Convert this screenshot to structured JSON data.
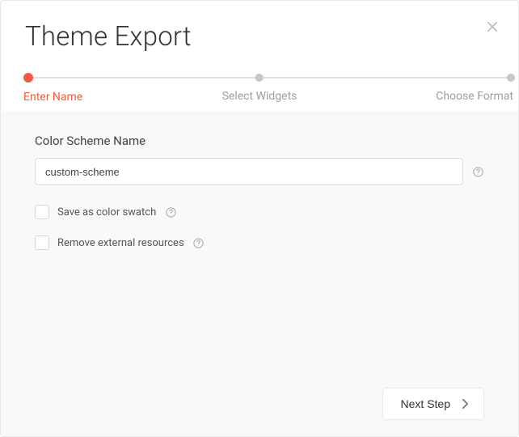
{
  "dialog": {
    "title": "Theme Export"
  },
  "stepper": {
    "steps": [
      {
        "label": "Enter Name",
        "active": true
      },
      {
        "label": "Select Widgets",
        "active": false
      },
      {
        "label": "Choose Format",
        "active": false
      }
    ]
  },
  "form": {
    "scheme_name_label": "Color Scheme Name",
    "scheme_name_value": "custom-scheme",
    "save_swatch_label": "Save as color swatch",
    "remove_external_label": "Remove external resources"
  },
  "footer": {
    "next_label": "Next Step"
  },
  "colors": {
    "accent": "#f05b41"
  }
}
